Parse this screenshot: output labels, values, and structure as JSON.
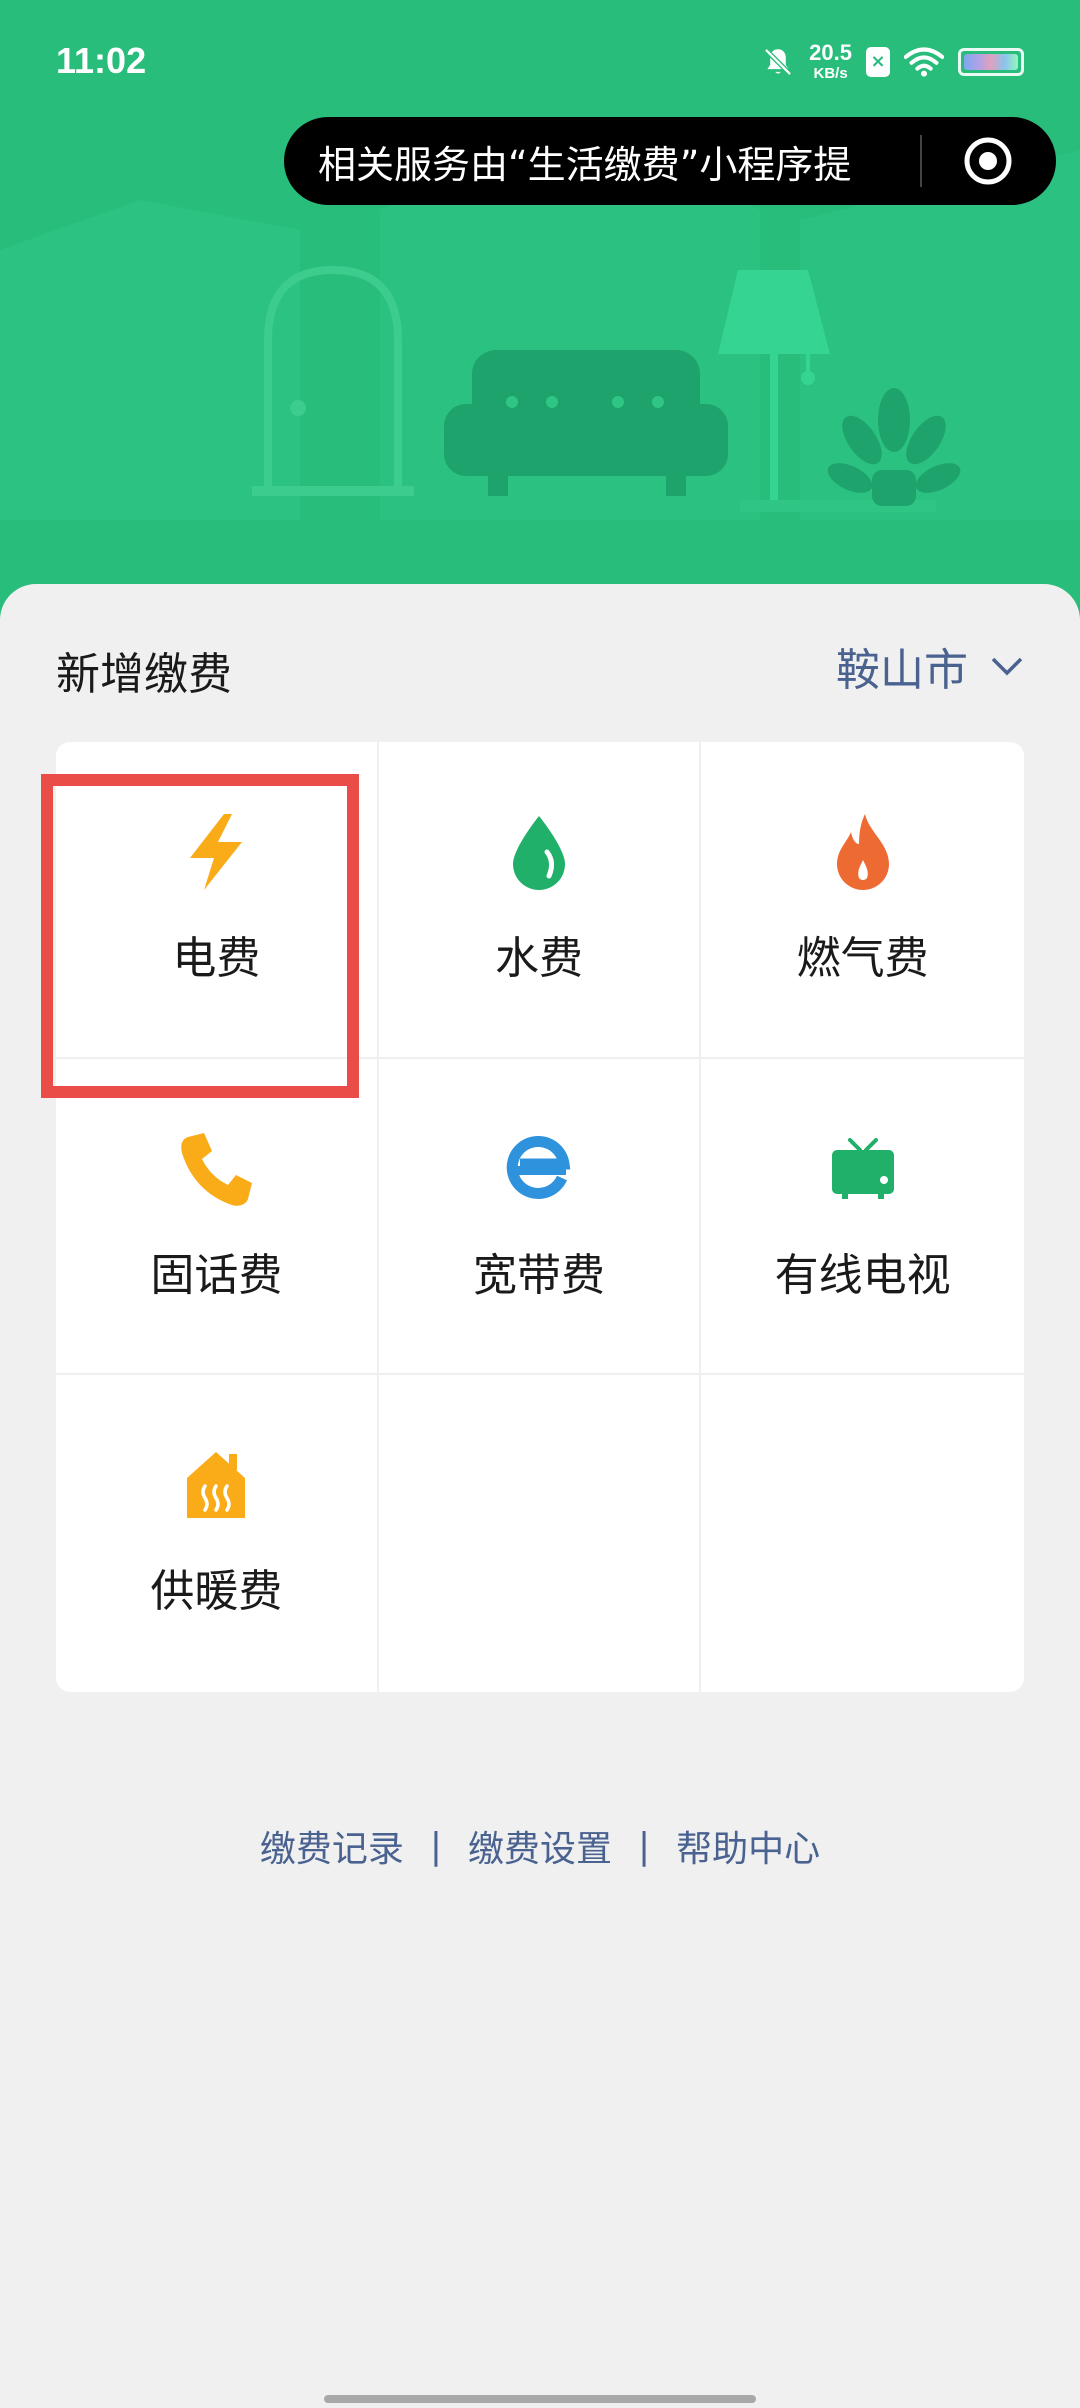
{
  "status_bar": {
    "time": "11:02",
    "net_speed_value": "20.5",
    "net_speed_unit": "KB/s",
    "badge": "×"
  },
  "capsule": {
    "text": "相关服务由“生活缴费”小程序提"
  },
  "section": {
    "title": "新增缴费",
    "city": "鞍山市"
  },
  "services": [
    {
      "label": "电费",
      "icon": "lightning-icon",
      "color": "#f9ac17"
    },
    {
      "label": "水费",
      "icon": "water-drop-icon",
      "color": "#20b06a"
    },
    {
      "label": "燃气费",
      "icon": "flame-icon",
      "color": "#ee6a33"
    },
    {
      "label": "固话费",
      "icon": "phone-icon",
      "color": "#f9ac17"
    },
    {
      "label": "宽带费",
      "icon": "broadband-e-icon",
      "color": "#2f92dd"
    },
    {
      "label": "有线电视",
      "icon": "tv-icon",
      "color": "#20b06a"
    },
    {
      "label": "供暖费",
      "icon": "heating-house-icon",
      "color": "#f9ac17"
    }
  ],
  "footer": {
    "records": "缴费记录",
    "settings": "缴费设置",
    "help": "帮助中心",
    "separator": "|"
  },
  "colors": {
    "header_green": "#29bd7c",
    "link_blue": "#4a6290",
    "highlight_red": "#ea4d48"
  }
}
